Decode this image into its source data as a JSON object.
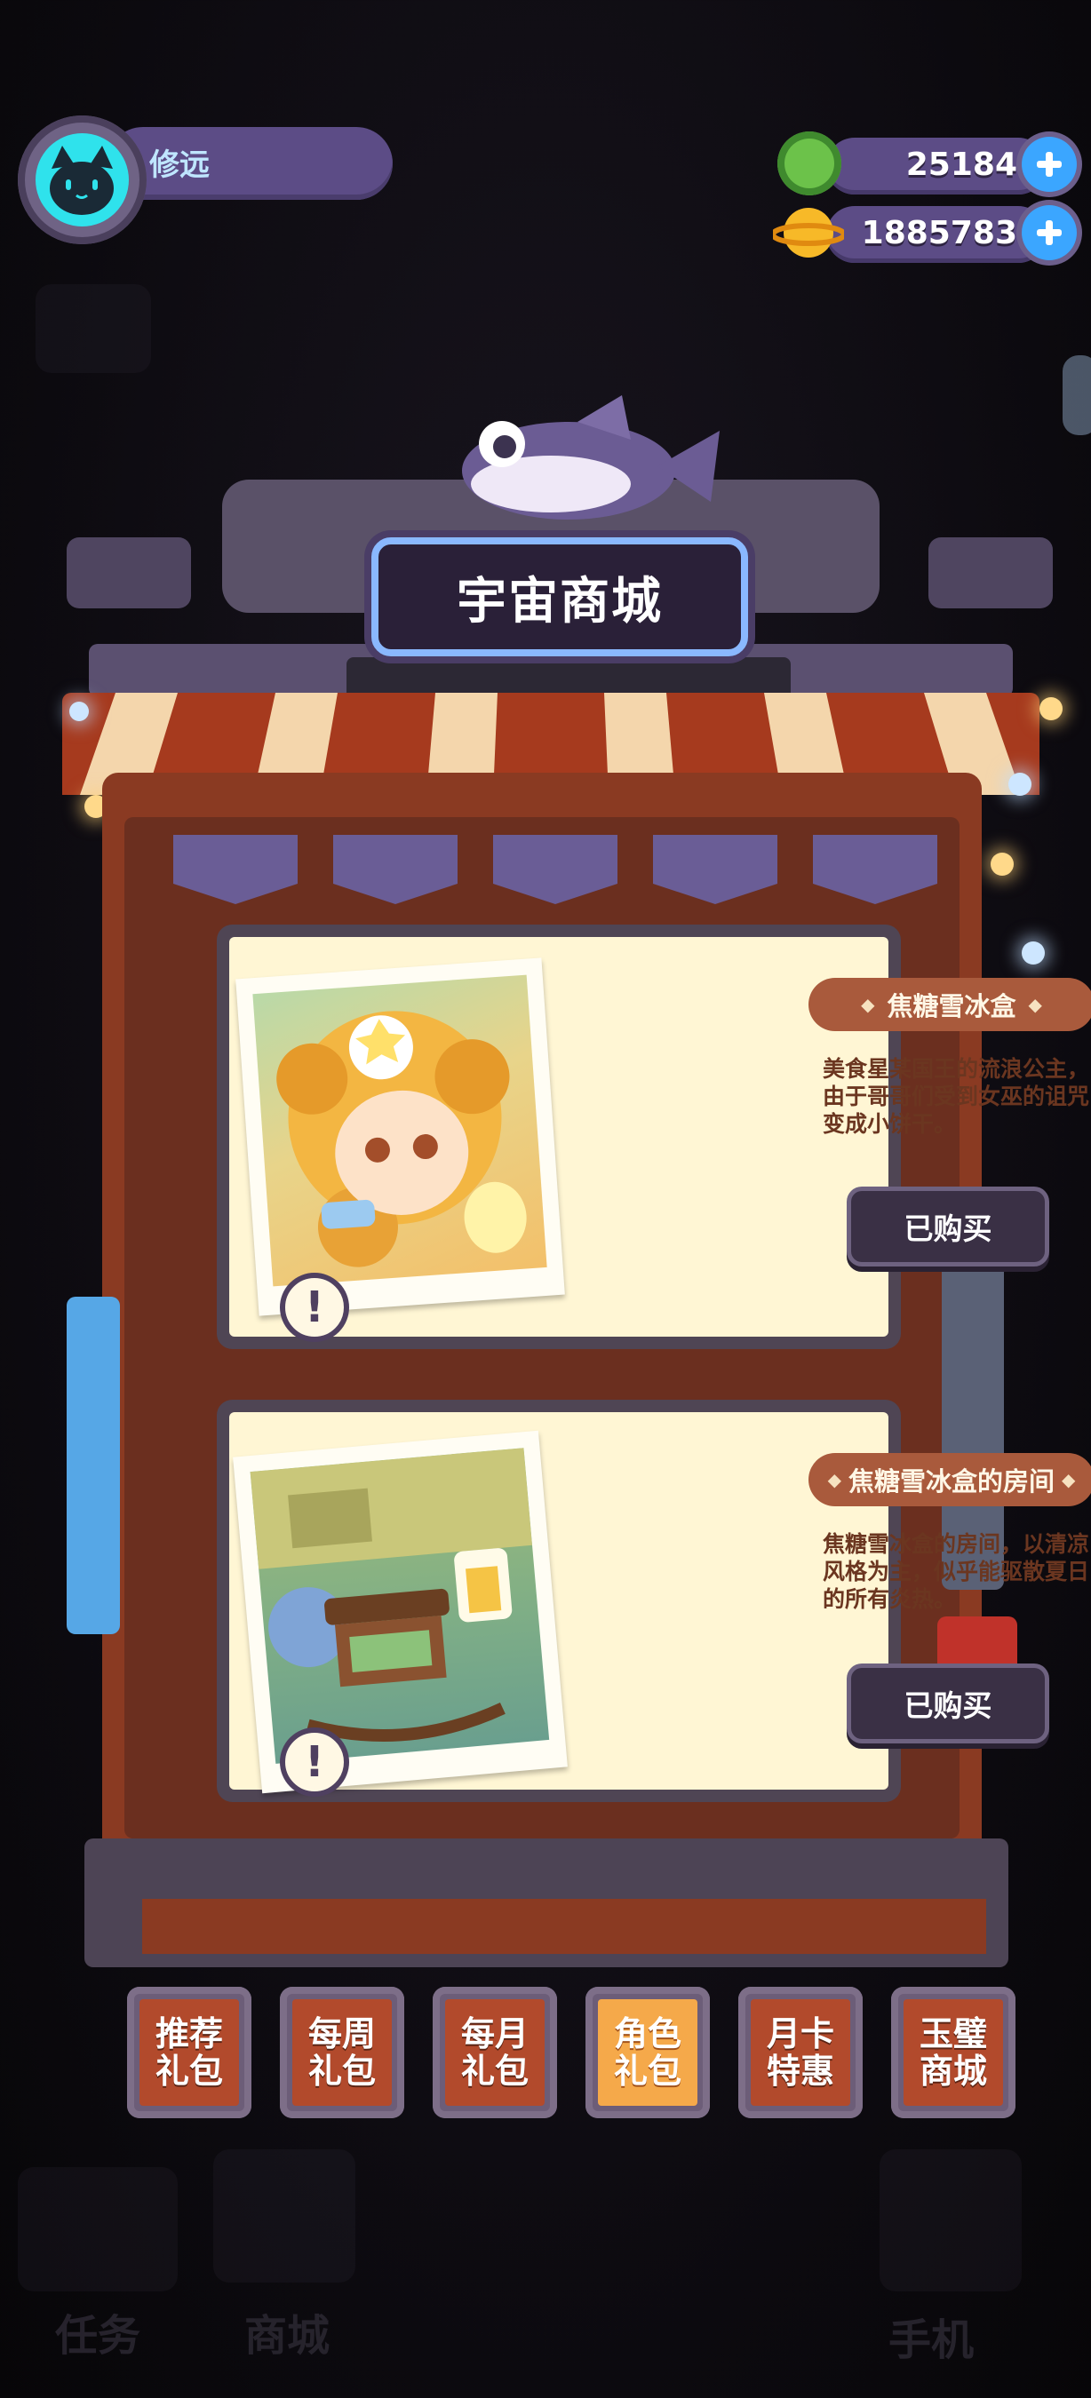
{
  "player": {
    "name": "修远"
  },
  "currencies": [
    {
      "icon": "green-gem-icon",
      "value": "25184"
    },
    {
      "icon": "gold-planet-coin-icon",
      "value": "1885783"
    }
  ],
  "shop": {
    "title": "宇宙商城",
    "items": [
      {
        "name": "焦糖雪冰盒",
        "description": "美食星某国王的流浪公主，由于哥哥们受到女巫的诅咒变成小饼干。",
        "button": "已购买"
      },
      {
        "name": "焦糖雪冰盒的房间",
        "description": "焦糖雪冰盒的房间，以清凉风格为主，似乎能驱散夏日的所有炎热。",
        "button": "已购买"
      }
    ]
  },
  "tabs": [
    {
      "label": "推荐\n礼包",
      "active": false
    },
    {
      "label": "每周\n礼包",
      "active": false
    },
    {
      "label": "每月\n礼包",
      "active": false
    },
    {
      "label": "角色\n礼包",
      "active": true
    },
    {
      "label": "月卡\n特惠",
      "active": false
    },
    {
      "label": "玉璧\n商城",
      "active": false
    }
  ],
  "background_nav": [
    "任务",
    "商城",
    "手机"
  ],
  "colors": {
    "accent": "#3ba6ff",
    "panel": "#5c4c86",
    "active_tab": "#f5a94a",
    "tab": "#b24a2c"
  }
}
